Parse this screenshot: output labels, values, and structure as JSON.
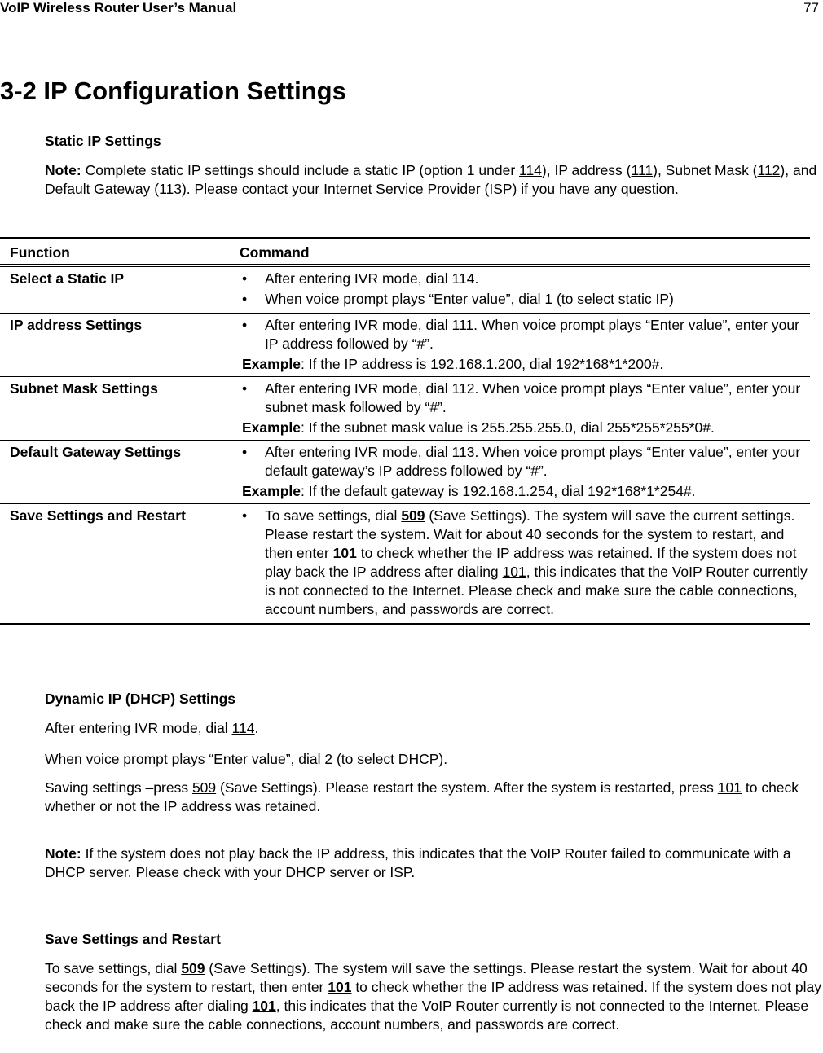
{
  "header": {
    "title": "VoIP Wireless Router User’s Manual",
    "page_number": "77"
  },
  "section_title": "3-2 IP Configuration Settings",
  "static_ip": {
    "heading": "Static IP Settings",
    "note_label": "Note:",
    "note_parts": [
      " Complete static IP settings should include a static IP (option 1 under ",
      "114",
      "), IP address (",
      "111",
      "), Subnet Mask (",
      "112",
      "), and Default Gateway (",
      "113",
      "). Please contact your Internet Service Provider (ISP) if you have any question."
    ]
  },
  "table": {
    "headers": {
      "function": "Function",
      "command": "Command"
    },
    "bullet": "•",
    "rows": [
      {
        "function": "Select a Static IP",
        "bullets": [
          "After entering IVR mode, dial 114.",
          "When voice prompt plays “Enter value”, dial 1 (to select static IP)"
        ]
      },
      {
        "function": "IP address Settings",
        "bullets": [
          "After entering IVR mode, dial 111. When voice prompt plays “Enter value”, enter your IP address followed by “#”."
        ],
        "example_label": "Example",
        "example_text": ": If the IP address is 192.168.1.200, dial 192*168*1*200#."
      },
      {
        "function": "Subnet Mask Settings",
        "bullets": [
          "After entering IVR mode, dial 112. When voice prompt plays “Enter value”, enter your subnet mask followed by “#”."
        ],
        "example_label": "Example",
        "example_text": ": If the subnet mask value is 255.255.255.0, dial 255*255*255*0#."
      },
      {
        "function": "Default Gateway Settings",
        "bullets": [
          "After entering IVR mode, dial 113. When voice prompt plays “Enter value”, enter your default gateway’s IP address followed by “#”."
        ],
        "example_label": "Example",
        "example_text": ": If the default gateway is 192.168.1.254, dial 192*168*1*254#."
      },
      {
        "function": "Save Settings and Restart",
        "save_parts": [
          "To save settings, dial ",
          "509",
          " (Save Settings). The system will save the current settings. Please restart the system. Wait for about 40 seconds for the system to restart, and then enter ",
          "101",
          " to check whether the IP address was retained. If the system does not play back the IP address after dialing ",
          "101",
          ", this indicates that the VoIP Router currently is not connected to the Internet. Please check and make sure the cable connections, account numbers, and passwords are correct."
        ]
      }
    ]
  },
  "dhcp": {
    "heading": "Dynamic IP (DHCP) Settings",
    "line1_parts": [
      "After entering IVR mode, dial ",
      "114",
      "."
    ],
    "line2": "When voice prompt plays “Enter value”, dial 2 (to select DHCP).",
    "line3_parts": [
      "Saving settings –press ",
      "509",
      " (Save Settings). Please restart the system. After the system is restarted, press ",
      "101",
      " to check whether or not the IP address was retained."
    ],
    "note_label": "Note:",
    "note_text": " If the system does not play back the IP address, this indicates that the VoIP Router failed to communicate with a DHCP server. Please check with your DHCP server or ISP."
  },
  "save_restart": {
    "heading": "Save Settings and Restart",
    "parts": [
      "To save settings, dial ",
      "509",
      " (Save Settings). The system will save the settings. Please restart the system. Wait for about 40 seconds for the system to restart, then enter ",
      "101",
      " to check whether the IP address was retained. If the system does not play back the IP address after dialing ",
      "101",
      ", this indicates that the VoIP Router currently is not connected to the Internet. Please check and make sure the cable connections, account numbers, and passwords are correct."
    ]
  }
}
